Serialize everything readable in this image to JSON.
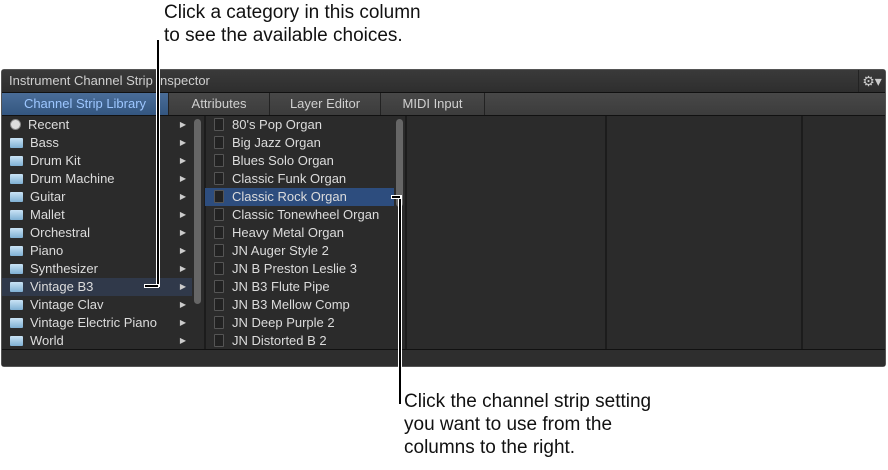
{
  "callouts": {
    "top": [
      "Click a category in this column",
      "to see the available choices."
    ],
    "bottom": [
      "Click the channel strip setting",
      "you want to use from the",
      "columns to the right."
    ]
  },
  "window": {
    "title": "Instrument Channel Strip Inspector",
    "gear_icon": "gear-icon"
  },
  "tabs": [
    {
      "label": "Channel Strip Library",
      "active": true
    },
    {
      "label": "Attributes"
    },
    {
      "label": "Layer Editor"
    },
    {
      "label": "MIDI Input"
    }
  ],
  "categories": [
    {
      "label": "Recent",
      "icon": "clock"
    },
    {
      "label": "Bass"
    },
    {
      "label": "Drum Kit"
    },
    {
      "label": "Drum Machine"
    },
    {
      "label": "Guitar"
    },
    {
      "label": "Mallet"
    },
    {
      "label": "Orchestral"
    },
    {
      "label": "Piano"
    },
    {
      "label": "Synthesizer"
    },
    {
      "label": "Vintage B3",
      "highlighted": true
    },
    {
      "label": "Vintage Clav"
    },
    {
      "label": "Vintage Electric Piano"
    },
    {
      "label": "World"
    }
  ],
  "settings": [
    {
      "label": "80's Pop Organ"
    },
    {
      "label": "Big Jazz Organ"
    },
    {
      "label": "Blues Solo Organ"
    },
    {
      "label": "Classic Funk Organ"
    },
    {
      "label": "Classic Rock Organ",
      "selected": true
    },
    {
      "label": "Classic Tonewheel Organ"
    },
    {
      "label": "Heavy Metal Organ"
    },
    {
      "label": "JN Auger Style 2"
    },
    {
      "label": "JN B Preston Leslie 3"
    },
    {
      "label": "JN B3 Flute Pipe"
    },
    {
      "label": "JN B3 Mellow Comp"
    },
    {
      "label": "JN Deep Purple 2"
    },
    {
      "label": "JN Distorted B 2"
    }
  ]
}
